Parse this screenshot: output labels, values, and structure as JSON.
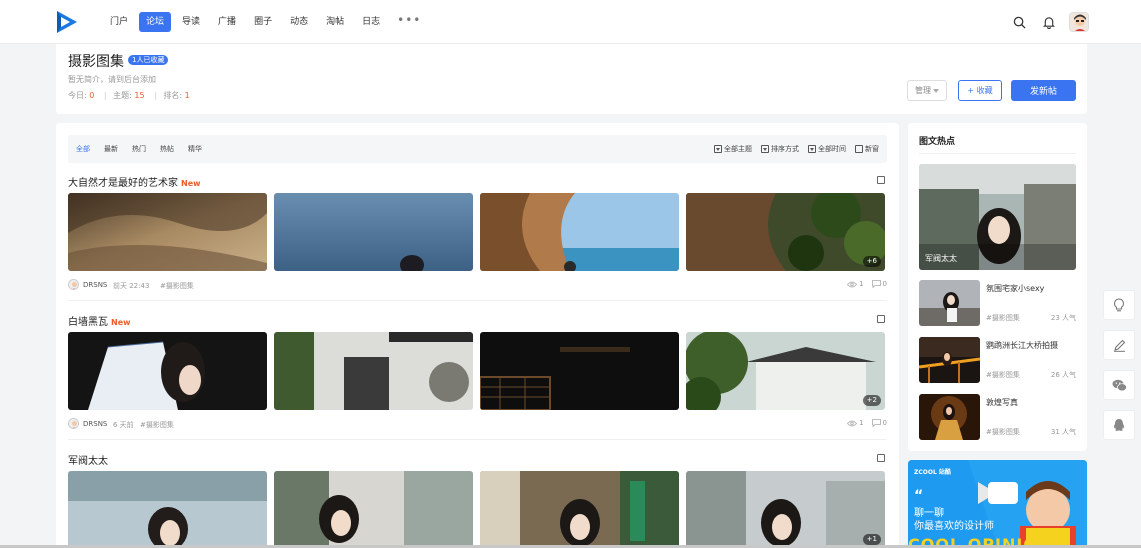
{
  "nav": {
    "items": [
      {
        "label": "门户",
        "active": false
      },
      {
        "label": "论坛",
        "active": true
      },
      {
        "label": "导读",
        "active": false
      },
      {
        "label": "广播",
        "active": false
      },
      {
        "label": "圈子",
        "active": false
      },
      {
        "label": "动态",
        "active": false
      },
      {
        "label": "淘帖",
        "active": false
      },
      {
        "label": "日志",
        "active": false
      }
    ],
    "more": "•••",
    "icons": [
      "search-icon",
      "bell-icon",
      "user-avatar"
    ]
  },
  "forum": {
    "title": "摄影图集",
    "fav_badge": "1人已收藏",
    "desc": "暂无简介，请到后台添加",
    "stats": {
      "today_label": "今日:",
      "today": "0",
      "topics_label": "主题:",
      "topics": "15",
      "rank_label": "排名:",
      "rank": "1"
    },
    "manage_label": "管理",
    "fav_label": "+ 收藏",
    "post_label": "发新帖"
  },
  "filter": {
    "tabs": [
      {
        "label": "全部",
        "active": true
      },
      {
        "label": "最新",
        "active": false
      },
      {
        "label": "热门",
        "active": false
      },
      {
        "label": "热帖",
        "active": false
      },
      {
        "label": "精华",
        "active": false
      }
    ],
    "options": [
      "全部主题",
      "排序方式",
      "全部时间",
      "新窗"
    ]
  },
  "threads": [
    {
      "title": "大自然才是最好的艺术家",
      "new_label": "New",
      "more": "+6",
      "author": "DRSNS",
      "time": "前天 22:43",
      "tag": "#摄影图集",
      "views": "1",
      "replies": "0"
    },
    {
      "title": "白墙黑瓦",
      "new_label": "New",
      "more": "+2",
      "author": "DRSNS",
      "time": "6 天前",
      "tag": "#摄影图集",
      "views": "1",
      "replies": "0"
    },
    {
      "title": "军阀太太",
      "new_label": "",
      "more": "+1",
      "author": "",
      "time": "",
      "tag": "",
      "views": "",
      "replies": ""
    }
  ],
  "sidebar": {
    "title": "图文热点",
    "main_caption": "军阀太太",
    "items": [
      {
        "name": "氛围宅家小sexy",
        "tag": "#摄影图集",
        "pop": "23 人气"
      },
      {
        "name": "鹦鹉洲长江大桥拍摄",
        "tag": "#摄影图集",
        "pop": "26 人气"
      },
      {
        "name": "敦煌写真",
        "tag": "#摄影图集",
        "pop": "31 人气"
      }
    ]
  },
  "ad": {
    "brand": "ZCOOL 站酷",
    "quote": "“",
    "line1": "聊一聊",
    "line2": "你最喜欢的设计师",
    "big": "COOL OPINION"
  },
  "float": {
    "icons": [
      "lightbulb-icon",
      "edit-icon",
      "wechat-icon",
      "qq-icon"
    ]
  },
  "colors": {
    "accent": "#3b74f0",
    "new": "#f25a29"
  }
}
